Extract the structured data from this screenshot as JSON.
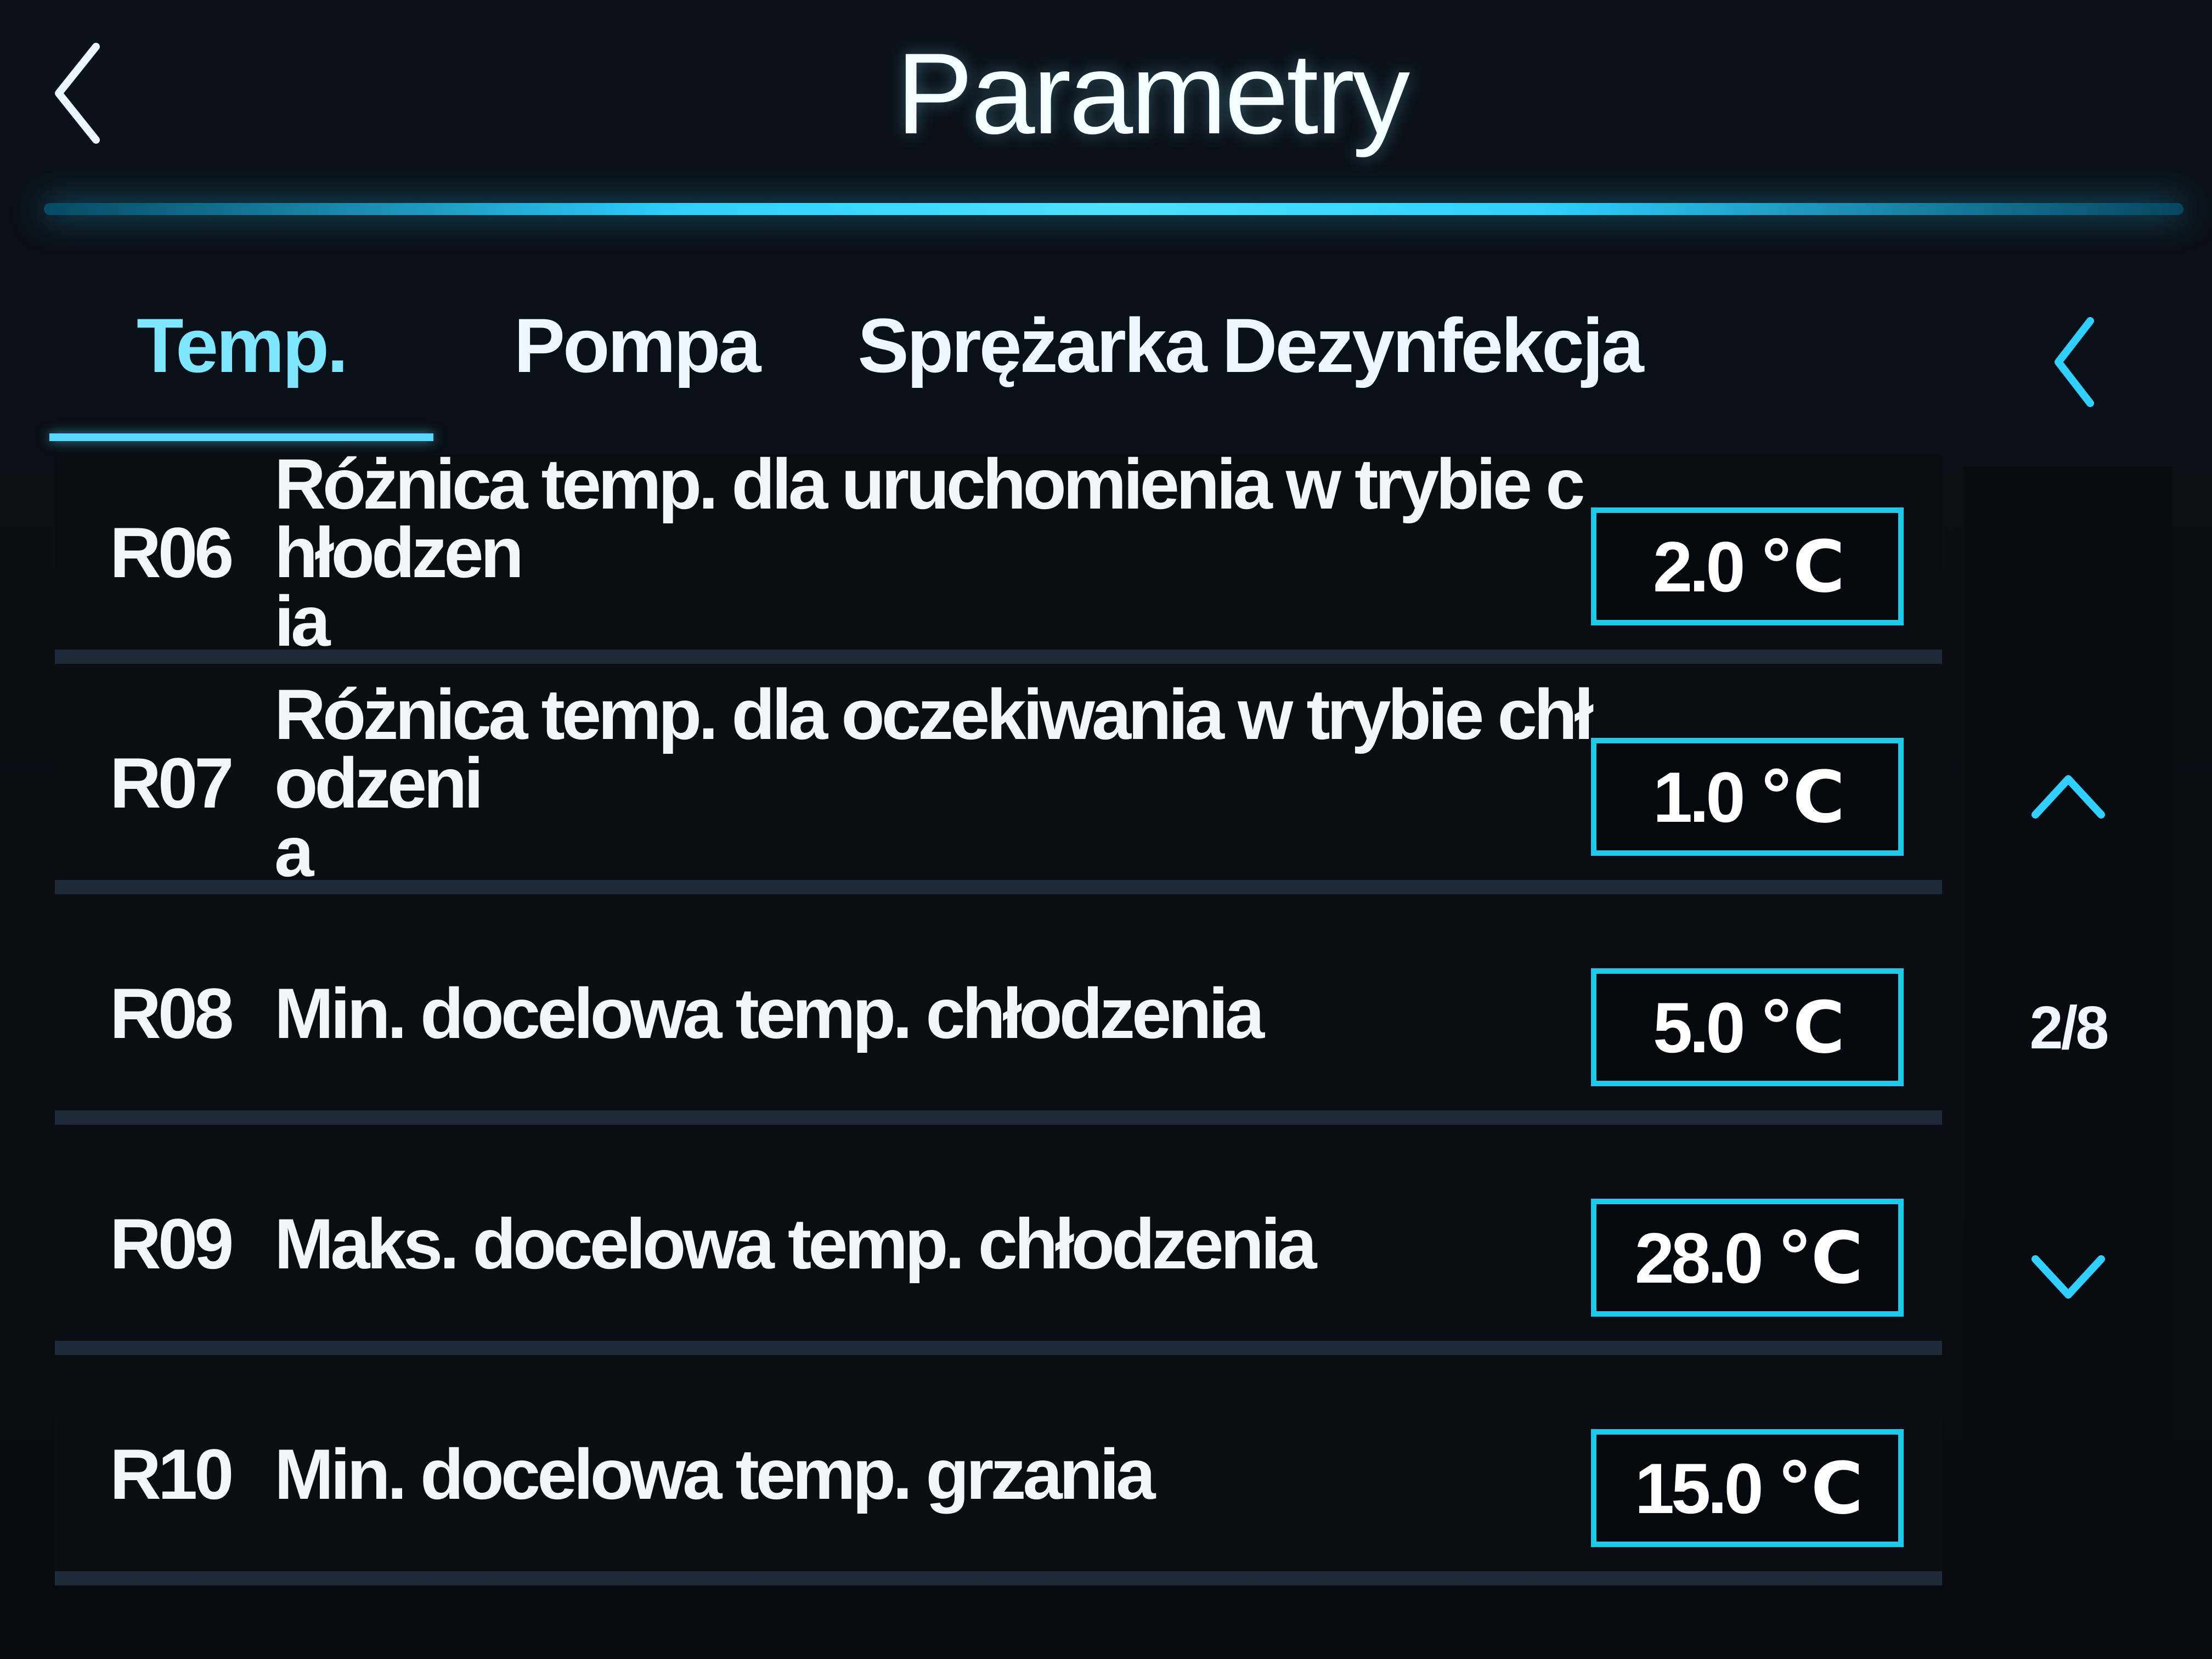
{
  "header": {
    "title": "Parametry",
    "back_icon": "chevron-left-icon"
  },
  "tabs": [
    {
      "label": "Temp.",
      "active": true
    },
    {
      "label": "Pompa",
      "active": false
    },
    {
      "label": "Sprężarka",
      "active": false
    },
    {
      "label": "Dezynfekcja",
      "active": false
    }
  ],
  "tabs_prev_icon": "chevron-left-icon",
  "rows": [
    {
      "code": "R06",
      "label": "Różnica temp. dla uruchomienia w trybie chłodzen\nia",
      "value": "2.0 ℃"
    },
    {
      "code": "R07",
      "label": "Różnica temp. dla oczekiwania w trybie chłodzeni\na",
      "value": "1.0 ℃"
    },
    {
      "code": "R08",
      "label": "Min. docelowa temp. chłodzenia",
      "value": "5.0 ℃"
    },
    {
      "code": "R09",
      "label": "Maks. docelowa temp. chłodzenia",
      "value": "28.0 ℃"
    },
    {
      "code": "R10",
      "label": "Min. docelowa temp. grzania",
      "value": "15.0 ℃"
    }
  ],
  "pager": {
    "page": "2/8",
    "up_icon": "chevron-up-icon",
    "down_icon": "chevron-down-icon"
  },
  "colors": {
    "accent": "#1ec9ea",
    "active_tab": "#7fe6ff",
    "background": "#0a0e14",
    "divider": "#1e2a38"
  }
}
